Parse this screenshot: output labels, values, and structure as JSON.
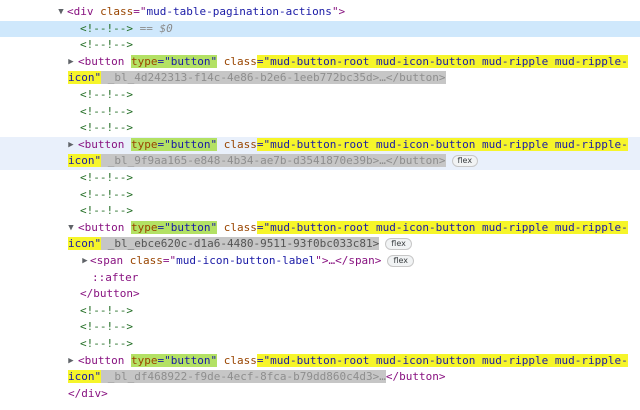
{
  "lines": {
    "l0": {
      "open": "<div ",
      "attr": "class",
      "eq": "=\"",
      "val": "mud-table-pagination-actions",
      "close": "\">"
    },
    "l1": {
      "comment": "<!--!-->",
      "suffix": " == $0"
    },
    "l2": {
      "comment": "<!--!-->"
    },
    "l3": {
      "open": "<button ",
      "type_attr": "type",
      "type_val": "=\"button\"",
      "class_attr": "class",
      "class_val": "=\"mud-button-root mud-icon-button mud-ripple mud-ripple-"
    },
    "l4": {
      "class_val_cont": "icon\"",
      "hash": " _bl_4d242313-f14c-4e86-b2e6-1eeb772bc35d>…</button>"
    },
    "l5": {
      "comment": "<!--!-->"
    },
    "l6": {
      "comment": "<!--!-->"
    },
    "l7": {
      "comment": "<!--!-->"
    },
    "l8": {
      "open": "<button ",
      "type_attr": "type",
      "type_val": "=\"button\"",
      "class_attr": "class",
      "class_val": "=\"mud-button-root mud-icon-button mud-ripple mud-ripple-"
    },
    "l9": {
      "class_val_cont": "icon\"",
      "hash": " _bl_9f9aa165-e848-4b34-ae7b-d3541870e39b>…</button>",
      "badge": "flex"
    },
    "l10": {
      "comment": "<!--!-->"
    },
    "l11": {
      "comment": "<!--!-->"
    },
    "l12": {
      "comment": "<!--!-->"
    },
    "l13": {
      "open": "<button ",
      "type_attr": "type",
      "type_val": "=\"button\"",
      "class_attr": "class",
      "class_val": "=\"mud-button-root mud-icon-button mud-ripple mud-ripple-"
    },
    "l14": {
      "class_val_cont": "icon\"",
      "hash": " _bl_ebce620c-d1a6-4480-9511-93f0bc033c81>",
      "badge": "flex"
    },
    "l15": {
      "open": "<span ",
      "attr": "class",
      "eq": "=\"",
      "val": "mud-icon-button-label",
      "close": "\">…</span>",
      "badge": "flex"
    },
    "l16": {
      "pseudo": "::after"
    },
    "l17": {
      "close_tag": "</button>"
    },
    "l18": {
      "comment": "<!--!-->"
    },
    "l19": {
      "comment": "<!--!-->"
    },
    "l20": {
      "comment": "<!--!-->"
    },
    "l21": {
      "open": "<button ",
      "type_attr": "type",
      "type_val": "=\"button\"",
      "class_attr": "class",
      "class_val": "=\"mud-button-root mud-icon-button mud-ripple mud-ripple-"
    },
    "l22": {
      "class_val_cont": "icon\"",
      "hash": " _bl_df468922-f9de-4ecf-8fca-b79dd860c4d3>…",
      "close_tag": "</button>"
    },
    "l23": {
      "close_tag": "</div>"
    }
  },
  "arrows": {
    "down": "▼",
    "right": "▶"
  }
}
